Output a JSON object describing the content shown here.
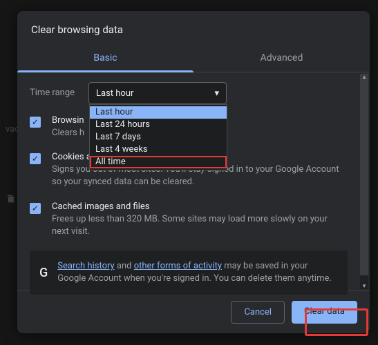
{
  "dialog": {
    "title": "Clear browsing data",
    "tabs": {
      "basic": "Basic",
      "advanced": "Advanced"
    },
    "time_range_label": "Time range",
    "select_value": "Last hour",
    "options": [
      "Last hour",
      "Last 24 hours",
      "Last 7 days",
      "Last 4 weeks",
      "All time"
    ],
    "items": [
      {
        "title": "Browsing history",
        "title_cut": "Browsin",
        "desc": "Clears h",
        "checked": true
      },
      {
        "title": "Cookies and other site data",
        "desc": "Signs you out of most sites. You'll stay signed in to your Google Account so your synced data can be cleared.",
        "checked": true
      },
      {
        "title": "Cached images and files",
        "desc": "Frees up less than 320 MB. Some sites may load more slowly on your next visit.",
        "checked": true
      }
    ],
    "info": {
      "link1": "Search history",
      "mid1": " and ",
      "link2": "other forms of activity",
      "rest": " may be saved in your Google Account when you're signed in. You can delete them anytime."
    },
    "buttons": {
      "cancel": "Cancel",
      "clear": "Clear data"
    }
  }
}
